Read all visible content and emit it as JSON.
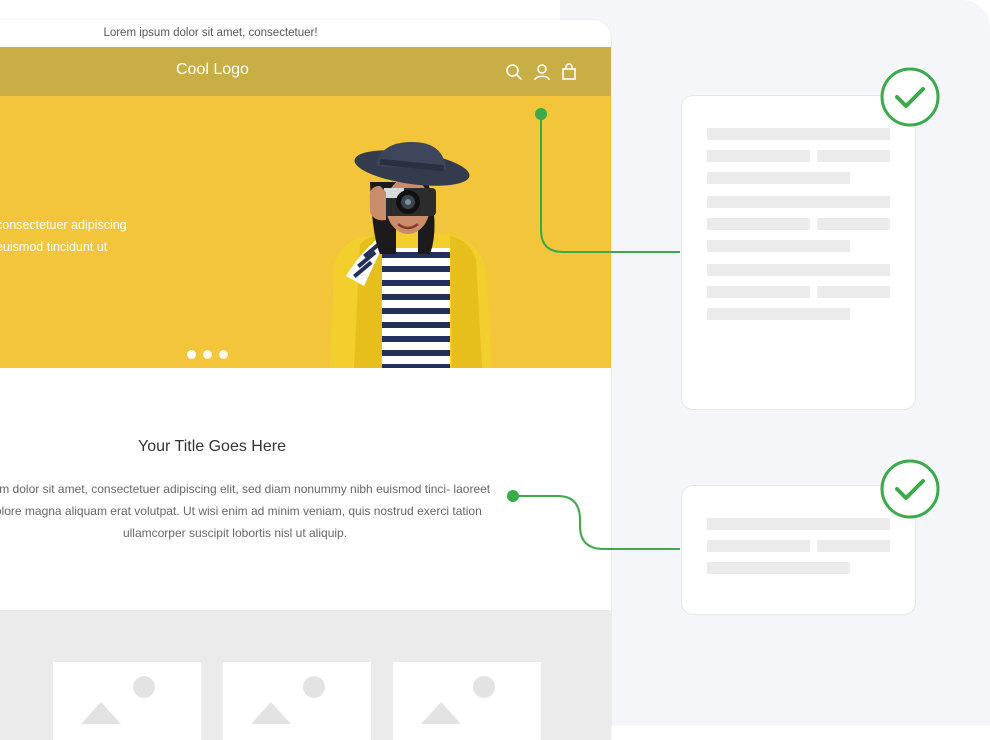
{
  "announcement": "Lorem ipsum dolor sit amet, consectetuer!",
  "header": {
    "logo": "Cool Logo",
    "icons": [
      "search-icon",
      "user-icon",
      "bag-icon"
    ]
  },
  "hero": {
    "text_line1": "consectetuer adipiscing",
    "text_line2": "euismod tincidunt ut",
    "carousel_dots": 3
  },
  "section": {
    "title": "Your Title Goes Here",
    "paragraph": "psum dolor sit amet, consectetuer adipiscing elit, sed diam nonummy nibh euismod tinci- laoreet dolore magna aliquam erat volutpat. Ut wisi enim ad minim veniam, quis nostrud exerci tation ullamcorper suscipit lobortis nisl ut aliquip."
  },
  "colors": {
    "header": "#c9ad45",
    "hero": "#f3c53b",
    "connector_green": "#3aaa4a"
  }
}
